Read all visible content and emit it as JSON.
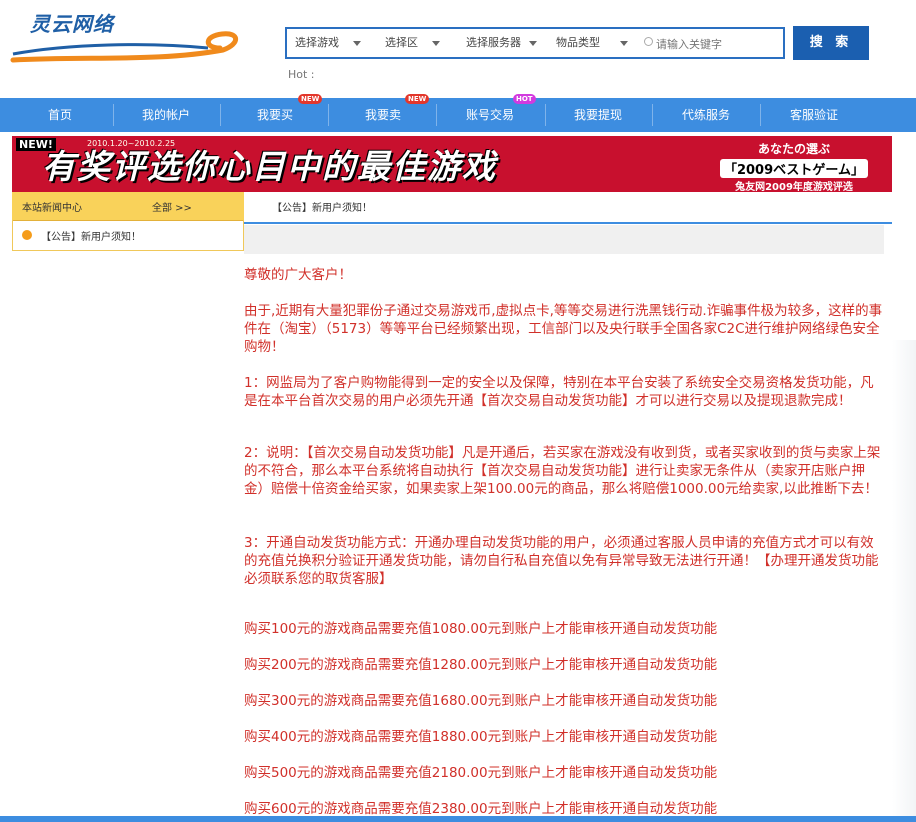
{
  "logo": {
    "text": "灵云网络"
  },
  "search": {
    "game_select": "选择游戏",
    "area_select": "选择区",
    "server_select": "选择服务器",
    "item_type_select": "物品类型",
    "keyword_placeholder": "请输入关键字",
    "button_label": "搜 索",
    "hot_label": "Hot :"
  },
  "nav": {
    "items": [
      {
        "label": "首页"
      },
      {
        "label": "我的帐户"
      },
      {
        "label": "我要买",
        "badge": "NEW"
      },
      {
        "label": "我要卖",
        "badge": "NEW"
      },
      {
        "label": "账号交易",
        "badge": "HOT"
      },
      {
        "label": "我要提现"
      },
      {
        "label": "代练服务"
      },
      {
        "label": "客服验证"
      }
    ]
  },
  "banner": {
    "new_tag": "NEW!",
    "date": "2010.1.20~2010.2.25",
    "main_text": "有奖评选你心目中的最佳游戏",
    "right_line1": "あなたの選ぶ",
    "right_line2": "「2009ベストゲーム」",
    "right_line3": "兔友网2009年度游戏评选"
  },
  "news": {
    "title": "本站新闻中心",
    "all_link": "全部 >>",
    "items": [
      "【公告】新用户须知！"
    ]
  },
  "notice": {
    "title": "【公告】新用户须知！"
  },
  "content": {
    "greeting": "尊敬的广大客户！",
    "para1": "由于,近期有大量犯罪份子通过交易游戏币,虚拟点卡,等等交易进行洗黑钱行动.诈骗事件极为较多，这样的事件在（淘宝）（5173）等等平台已经频繁出现，工信部门以及央行联手全国各家C2C进行维护网络绿色安全购物！",
    "para2": "1：网监局为了客户购物能得到一定的安全以及保障，特别在本平台安装了系统安全交易资格发货功能，凡是在本平台首次交易的用户必须先开通【首次交易自动发货功能】才可以进行交易以及提现退款完成！",
    "para3": "2：说明：【首次交易自动发货功能】凡是开通后，若买家在游戏没有收到货，或者买家收到的货与卖家上架的不符合，那么本平台系统将自动执行【首次交易自动发货功能】进行让卖家无条件从（卖家开店账户押金）赔偿十倍资金给买家，如果卖家上架100.00元的商品，那么将赔偿1000.00元给卖家,以此推断下去！",
    "para4": "3：开通自动发货功能方式：开通办理自动发货功能的用户，必须通过客服人员申请的充值方式才可以有效的充值兑换积分验证开通发货功能，请勿自行私自充值以免有异常导致无法进行开通！【办理开通发货功能必须联系您的取货客服】",
    "prices": [
      "购买100元的游戏商品需要充值1080.00元到账户上才能审核开通自动发货功能",
      "购买200元的游戏商品需要充值1280.00元到账户上才能审核开通自动发货功能",
      "购买300元的游戏商品需要充值1680.00元到账户上才能审核开通自动发货功能",
      "购买400元的游戏商品需要充值1880.00元到账户上才能审核开通自动发货功能",
      "购买500元的游戏商品需要充值2180.00元到账户上才能审核开通自动发货功能",
      "购买600元的游戏商品需要充值2380.00元到账户上才能审核开通自动发货功能"
    ]
  },
  "colors": {
    "nav_blue": "#3d8de0",
    "search_blue": "#1b5fb0",
    "text_red": "#d1302a",
    "banner_red": "#c8102e",
    "news_yellow": "#f9d25a"
  }
}
